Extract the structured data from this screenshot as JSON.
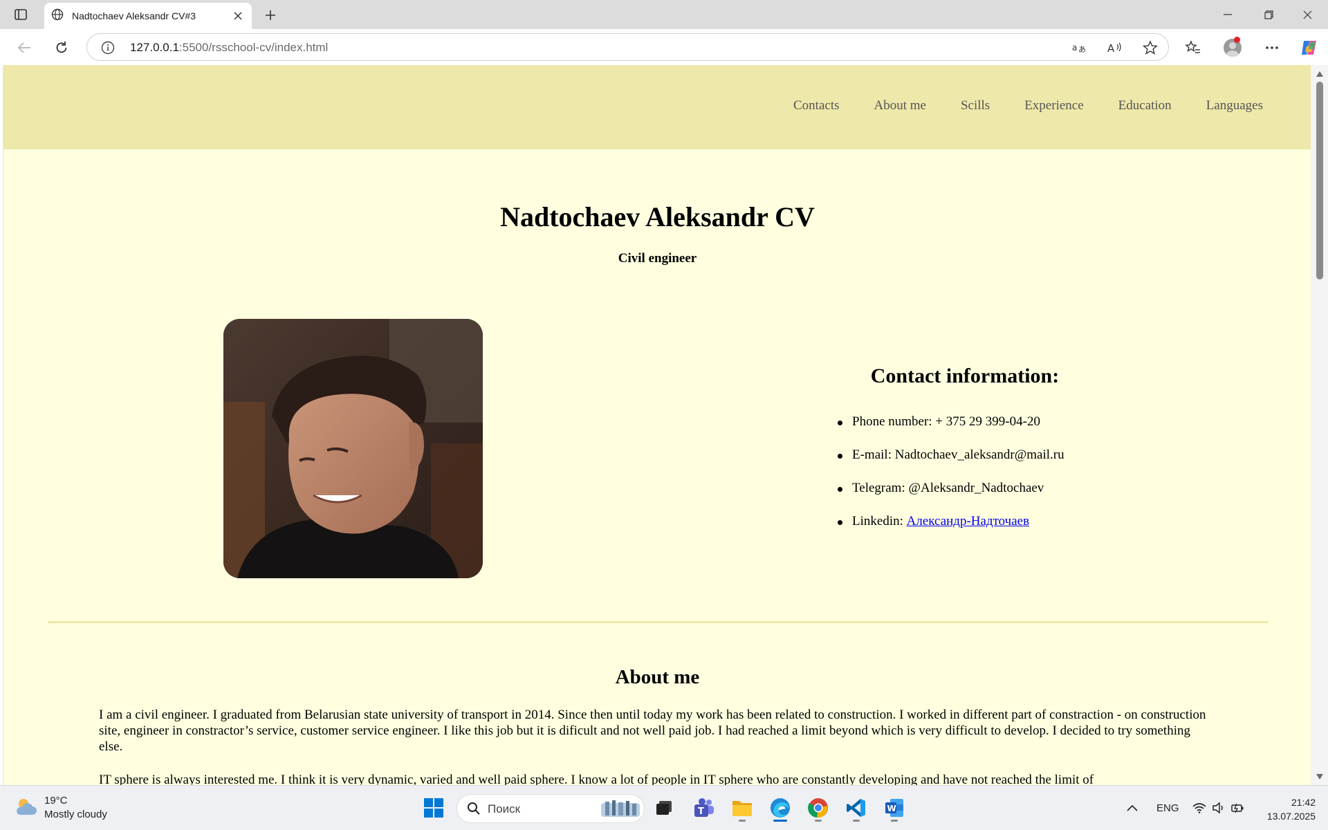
{
  "browser": {
    "tab_title": "Nadtochaev Aleksandr CV#3",
    "url_host": "127.0.0.1",
    "url_rest": ":5500/rsschool-cv/index.html"
  },
  "site": {
    "nav": [
      "Contacts",
      "About me",
      "Scills",
      "Experience",
      "Education",
      "Languages"
    ],
    "title": "Nadtochaev Aleksandr CV",
    "subtitle": "Civil engineer",
    "contact": {
      "heading": "Contact information:",
      "phone_label": "Phone number: + 375 29 399-04-20",
      "email_label": "E-mail: Nadtochaev_aleksandr@mail.ru",
      "telegram_label": "Telegram: @Aleksandr_Nadtochaev",
      "linkedin_label": "Linkedin: ",
      "linkedin_link": "Александр-Надточаев"
    },
    "about": {
      "heading": "About me",
      "paragraph1": "I am a civil engineer. I graduated from Belarusian state university of transport in 2014. Since then until today my work has been related to construction. I worked in different part of constraction - on construction site, engineer in constractor’s service, customer service engineer. I like this job but it is dificult and not well paid job. I had reached a limit beyond which is very difficult to develop. I decided to try something else.",
      "paragraph2": "IT sphere is always interested me. I think it is very dynamic, varied and well paid sphere. I know a lot of people in IT sphere who are constantly developing and have not reached the limit of"
    }
  },
  "taskbar": {
    "weather_temp": "19°C",
    "weather_desc": "Mostly cloudy",
    "search_placeholder": "Поиск",
    "language": "ENG",
    "time": "21:42",
    "date": "13.07.2025"
  },
  "colors": {
    "header_bg": "#eee8aa",
    "page_bg": "#ffffe0",
    "link": "#0000ee"
  }
}
